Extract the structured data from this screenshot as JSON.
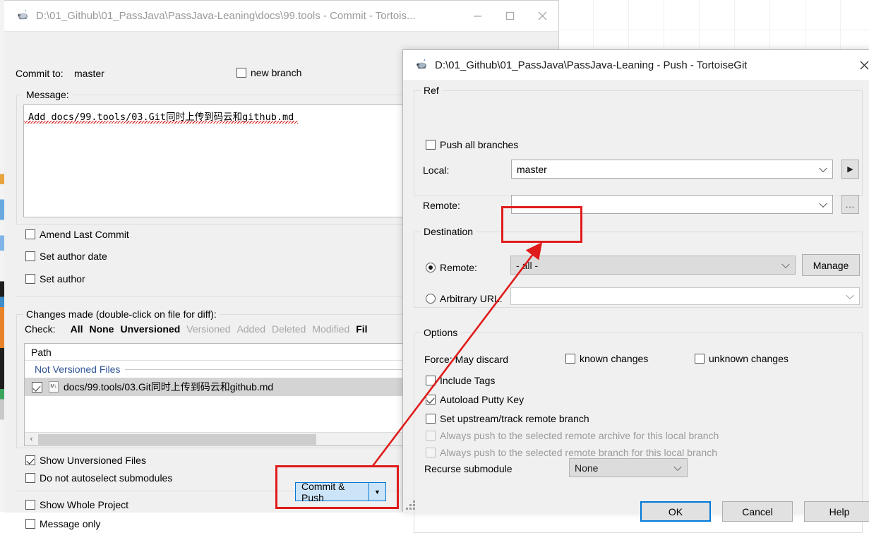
{
  "commit_window": {
    "title": "D:\\01_Github\\01_PassJava\\PassJava-Leaning\\docs\\99.tools - Commit - Tortois...",
    "icon": "tortoisegit-turtle-icon",
    "buttons": {
      "minimize": "—",
      "maximize": "☐",
      "close": "✕"
    },
    "commit_to_label": "Commit to:",
    "branch_value": "master",
    "new_branch_label": "new branch",
    "message_group_title": "Message:",
    "message_value": "Add docs/99.tools/03.Git同时上传到码云和github.md",
    "options": [
      {
        "label": "Amend Last Commit",
        "checked": false
      },
      {
        "label": "Set author date",
        "checked": false
      },
      {
        "label": "Set author",
        "checked": false
      }
    ],
    "changes_group_title": "Changes made (double-click on file for diff):",
    "check_label": "Check:",
    "check_links": [
      {
        "label": "All",
        "enabled": true
      },
      {
        "label": "None",
        "enabled": true
      },
      {
        "label": "Unversioned",
        "enabled": true
      },
      {
        "label": "Versioned",
        "enabled": false
      },
      {
        "label": "Added",
        "enabled": false
      },
      {
        "label": "Deleted",
        "enabled": false
      },
      {
        "label": "Modified",
        "enabled": false
      },
      {
        "label": "Fil",
        "enabled": true
      }
    ],
    "file_list": {
      "column_header": "Path",
      "group_label": "Not Versioned Files",
      "rows": [
        {
          "checked": true,
          "icon": "markdown-file-icon",
          "name": "docs/99.tools/03.Git同时上传到码云和github.md"
        }
      ],
      "scroll_left_arrow": "‹"
    },
    "bottom_options": [
      {
        "label": "Show Unversioned Files",
        "checked": true
      },
      {
        "label": "Do not autoselect submodules",
        "checked": false
      },
      {
        "label": "Show Whole Project",
        "checked": false
      },
      {
        "label": "Message only",
        "checked": false
      }
    ],
    "commit_push_button": "Commit & Push",
    "commit_push_underline_char": "P",
    "dropdown_arrow": "▼"
  },
  "push_window": {
    "title": "D:\\01_Github\\01_PassJava\\PassJava-Leaning - Push - TortoiseGit",
    "icon": "tortoisegit-turtle-icon",
    "close_button": "✕",
    "ref": {
      "group_title": "Ref",
      "push_all_branches": {
        "label": "Push all branches",
        "checked": false
      },
      "local_label": "Local:",
      "local_value": "master",
      "local_side_button": "▶",
      "remote_label": "Remote:",
      "remote_value": "",
      "remote_side_button": "..."
    },
    "destination": {
      "group_title": "Destination",
      "remote_radio": {
        "label": "Remote:",
        "selected": true
      },
      "remote_value": "- all -",
      "manage_button": "Manage",
      "arbitrary_radio": {
        "label": "Arbitrary URL:",
        "selected": false
      },
      "arbitrary_value": ""
    },
    "options": {
      "group_title": "Options",
      "force_label": "Force: May discard",
      "known_changes": {
        "label": "known changes",
        "checked": false
      },
      "unknown_changes": {
        "label": "unknown changes",
        "checked": false
      },
      "checkboxes": [
        {
          "label": "Include Tags",
          "checked": false,
          "enabled": true
        },
        {
          "label": "Autoload Putty Key",
          "checked": true,
          "enabled": true
        },
        {
          "label": "Set upstream/track remote branch",
          "checked": false,
          "enabled": true
        },
        {
          "label": "Always push to the selected remote archive for this local branch",
          "checked": false,
          "enabled": false
        },
        {
          "label": "Always push to the selected remote branch for this local branch",
          "checked": false,
          "enabled": false
        }
      ],
      "recurse_label": "Recurse submodule",
      "recurse_value": "None"
    },
    "footer": {
      "ok": "OK",
      "cancel": "Cancel",
      "help": "Help"
    }
  },
  "annotations": {
    "accent_color": "#e01b1b",
    "highlight_remote_dropdown": true,
    "highlight_commit_push_button": true,
    "arrow_from": "commit-push-button",
    "arrow_to": "remote-destination-dropdown"
  }
}
